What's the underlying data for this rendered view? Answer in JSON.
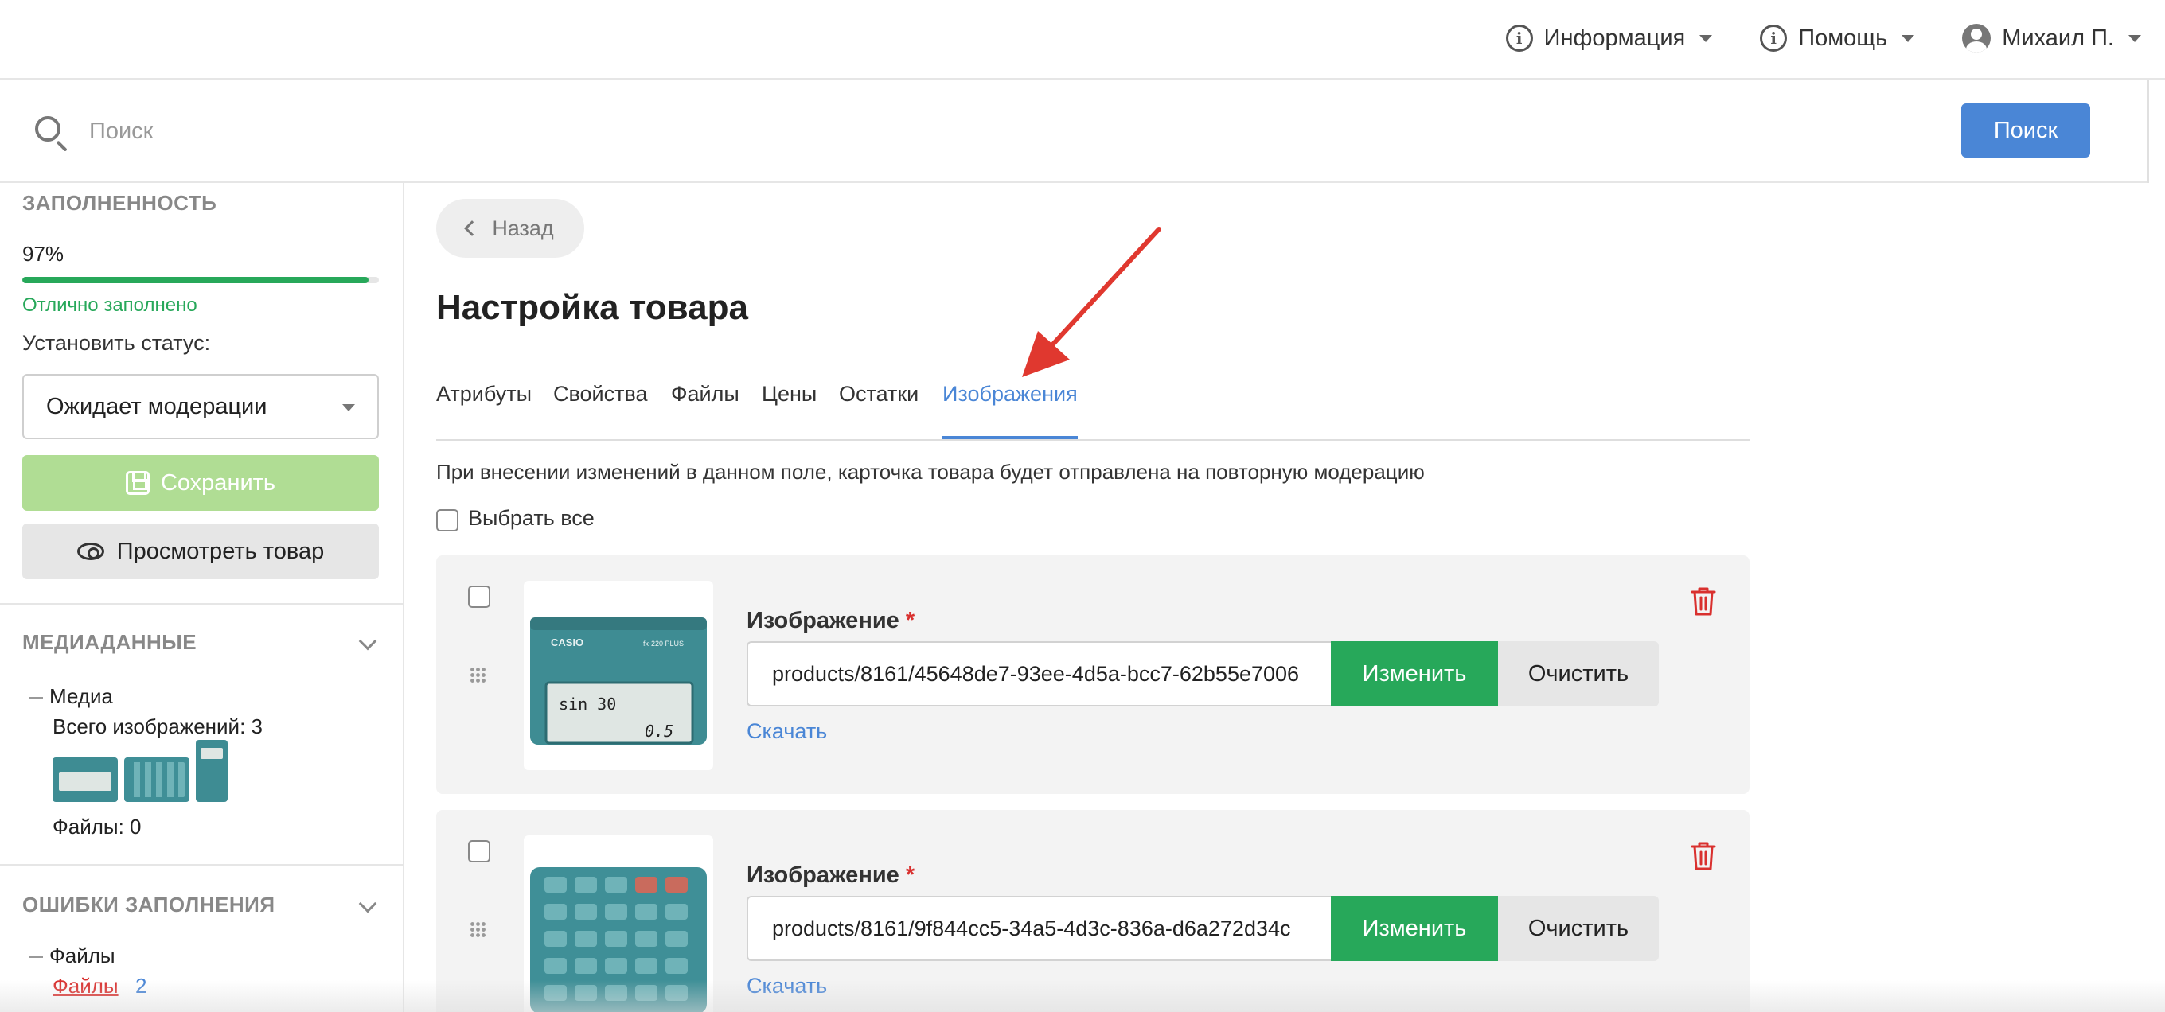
{
  "header": {
    "nav": [
      {
        "label": "Информация",
        "icon": "info-icon"
      },
      {
        "label": "Помощь",
        "icon": "info-icon"
      },
      {
        "label": "Михаил П.",
        "icon": "user-icon"
      }
    ]
  },
  "search": {
    "placeholder": "Поиск",
    "button_label": "Поиск"
  },
  "sidebar": {
    "completeness": {
      "title": "ЗАПОЛНЕННОСТЬ",
      "percent_text": "97%",
      "percent": 97,
      "status_text": "Отлично заполнено"
    },
    "set_status_label": "Установить статус:",
    "status_value": "Ожидает модерации",
    "save_label": "Сохранить",
    "view_label": "Просмотреть товар",
    "media": {
      "title": "МЕДИАДАННЫЕ",
      "group": "Медиа",
      "images_total": "Всего изображений: 3",
      "files": "Файлы: 0"
    },
    "errors": {
      "title": "ОШИБКИ ЗАПОЛНЕНИЯ",
      "group": "Файлы",
      "link": "Файлы",
      "count": "2"
    }
  },
  "main": {
    "back_label": "Назад",
    "title": "Настройка товара",
    "tabs": [
      {
        "label": "Атрибуты"
      },
      {
        "label": "Свойства"
      },
      {
        "label": "Файлы"
      },
      {
        "label": "Цены"
      },
      {
        "label": "Остатки"
      },
      {
        "label": "Изображения",
        "active": true
      }
    ],
    "notice": "При внесении изменений в данном поле, карточка товара будет отправлена на повторную модерацию",
    "select_all_label": "Выбрать все",
    "images": [
      {
        "label": "Изображение",
        "path": "products/8161/45648de7-93ee-4d5a-bcc7-62b55e7006",
        "change_label": "Изменить",
        "clear_label": "Очистить",
        "download_label": "Скачать",
        "calc_brand": "CASIO",
        "calc_model": "fx-220 PLUS",
        "calc_screen_top": "sin 30",
        "calc_screen_result": "0.5"
      },
      {
        "label": "Изображение",
        "path": "products/8161/9f844cc5-34a5-4d3c-836a-d6a272d34c",
        "change_label": "Изменить",
        "clear_label": "Очистить",
        "download_label": "Скачать"
      }
    ]
  },
  "colors": {
    "accent_blue": "#4a86d6",
    "success_green": "#27a85a",
    "danger_red": "#d9302e",
    "arrow_red": "#e0382f"
  }
}
